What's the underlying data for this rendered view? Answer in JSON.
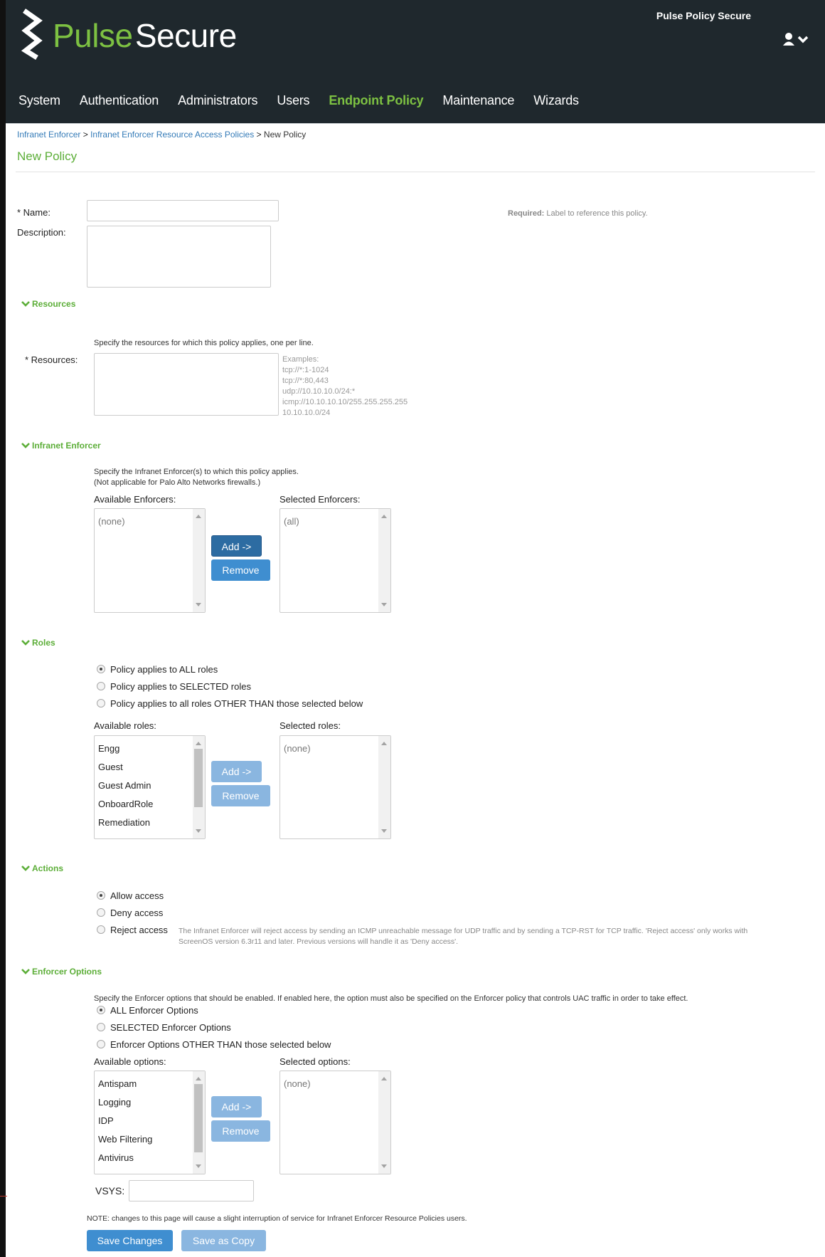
{
  "header": {
    "brand_first": "Pulse",
    "brand_second": "Secure",
    "product": "Pulse Policy Secure",
    "user_icon": "user-icon",
    "menu_icon": "chevron-down-icon"
  },
  "nav": [
    {
      "label": "System"
    },
    {
      "label": "Authentication"
    },
    {
      "label": "Administrators"
    },
    {
      "label": "Users"
    },
    {
      "label": "Endpoint Policy",
      "active": true
    },
    {
      "label": "Maintenance"
    },
    {
      "label": "Wizards"
    }
  ],
  "breadcrumb": {
    "crumb1": "Infranet Enforcer",
    "sep": ">",
    "crumb2": "Infranet Enforcer Resource Access Policies",
    "current": "New Policy"
  },
  "page_title": "New Policy",
  "form": {
    "name_label": "* Name:",
    "name_value": "",
    "name_hint_bold": "Required:",
    "name_hint": "Label to reference this policy.",
    "description_label": "Description:",
    "description_value": ""
  },
  "resources": {
    "heading": "Resources",
    "intro": "Specify the resources for which this policy applies, one per line.",
    "label": "* Resources:",
    "value": "",
    "examples": [
      "Examples:",
      "tcp://*:1-1024",
      "tcp://*:80,443",
      "udp://10.10.10.0/24:*",
      "icmp://10.10.10.10/255.255.255.255",
      "10.10.10.0/24"
    ]
  },
  "infranet": {
    "heading": "Infranet Enforcer",
    "intro1": "Specify the Infranet Enforcer(s) to which this policy applies.",
    "intro2": "(Not applicable for Palo Alto Networks firewalls.)",
    "available_label": "Available Enforcers:",
    "available": [
      "(none)"
    ],
    "selected_label": "Selected Enforcers:",
    "selected": [
      "(all)"
    ],
    "add": "Add ->",
    "remove": "Remove"
  },
  "roles": {
    "heading": "Roles",
    "options": [
      "Policy applies to ALL roles",
      "Policy applies to SELECTED roles",
      "Policy applies to all roles OTHER THAN those selected below"
    ],
    "selected_option": 0,
    "available_label": "Available roles:",
    "available": [
      "Engg",
      "Guest",
      "Guest Admin",
      "OnboardRole",
      "Remediation"
    ],
    "selected_label": "Selected roles:",
    "selected": [
      "(none)"
    ],
    "add": "Add ->",
    "remove": "Remove"
  },
  "actions": {
    "heading": "Actions",
    "options": [
      "Allow access",
      "Deny access",
      "Reject access"
    ],
    "selected_option": 0,
    "reject_note1": "The Infranet Enforcer will reject access by sending an ICMP unreachable message for UDP traffic and by sending a TCP-RST for TCP traffic. 'Reject access' only works with",
    "reject_note2": "ScreenOS version 6.3r11 and later. Previous versions will handle it as 'Deny access'."
  },
  "enforcer_options": {
    "heading": "Enforcer Options",
    "intro": "Specify the Enforcer options that should be enabled. If enabled here, the option must also be specified on the Enforcer policy that controls UAC traffic in order to take effect.",
    "options": [
      "ALL Enforcer Options",
      "SELECTED Enforcer Options",
      "Enforcer Options OTHER THAN those selected below"
    ],
    "selected_option": 0,
    "available_label": "Available options:",
    "available": [
      "Antispam",
      "Logging",
      "IDP",
      "Web Filtering",
      "Antivirus"
    ],
    "selected_label": "Selected options:",
    "selected": [
      "(none)"
    ],
    "add": "Add ->",
    "remove": "Remove",
    "vsys_label": "VSYS:",
    "vsys_value": ""
  },
  "footer": {
    "note": "NOTE: changes to this page will cause a slight interruption of service for Infranet Enforcer Resource Policies users.",
    "save": "Save Changes",
    "save_copy": "Save as Copy"
  },
  "colors": {
    "header_bg": "#1f282d",
    "brand_green": "#7dc142",
    "link_blue": "#337ab7",
    "primary_button": "#3f8ed0"
  }
}
